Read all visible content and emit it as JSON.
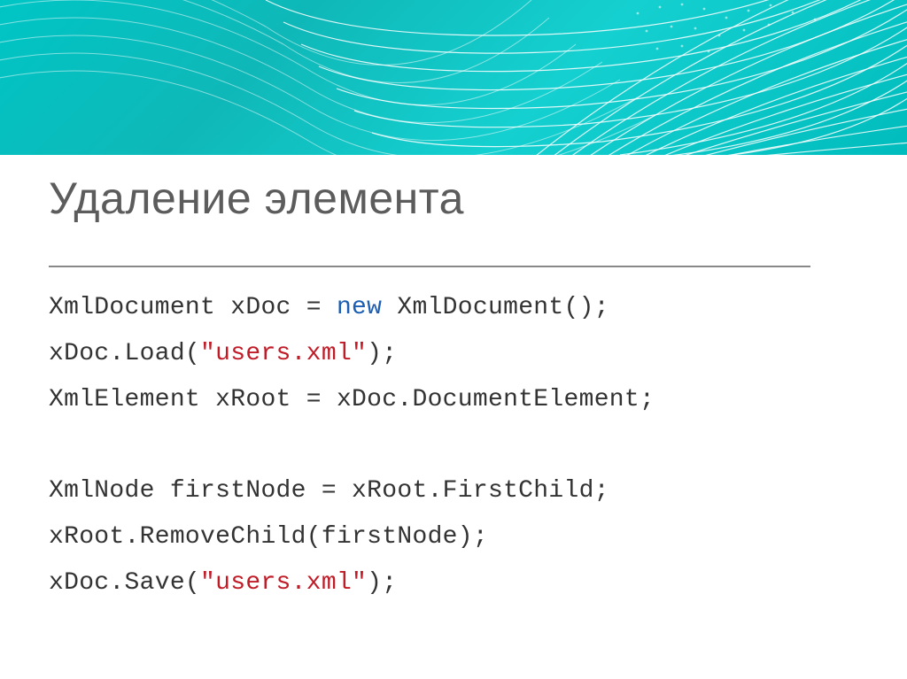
{
  "title": "Удаление элемента",
  "code": {
    "tokens": [
      {
        "t": "XmlDocument xDoc = "
      },
      {
        "t": "new",
        "c": "kw"
      },
      {
        "t": " XmlDocument();"
      },
      {
        "t": "\n"
      },
      {
        "t": "xDoc.Load("
      },
      {
        "t": "\"users.xml\"",
        "c": "str"
      },
      {
        "t": ");"
      },
      {
        "t": "\n"
      },
      {
        "t": "XmlElement xRoot = xDoc.DocumentElement;"
      },
      {
        "t": "\n"
      },
      {
        "t": "\n"
      },
      {
        "t": "XmlNode firstNode = xRoot.FirstChild;"
      },
      {
        "t": "\n"
      },
      {
        "t": "xRoot.RemoveChild(firstNode);"
      },
      {
        "t": "\n"
      },
      {
        "t": "xDoc.Save("
      },
      {
        "t": "\"users.xml\"",
        "c": "str"
      },
      {
        "t": ");"
      }
    ]
  }
}
